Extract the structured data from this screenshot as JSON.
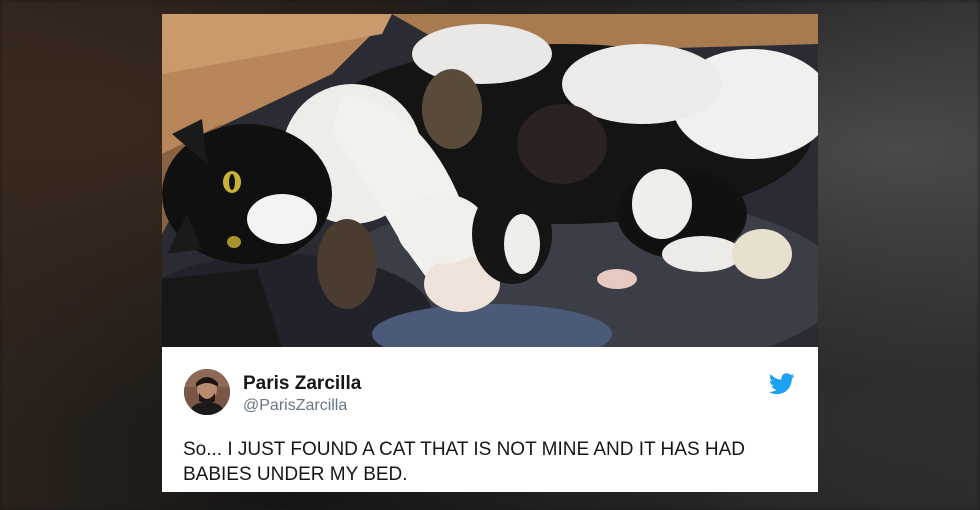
{
  "tweet": {
    "author_name": "Paris Zarcilla",
    "author_handle": "@ParisZarcilla",
    "text": "So... I JUST FOUND A CAT THAT IS NOT MINE AND IT HAS HAD BABIES UNDER MY BED."
  },
  "icons": {
    "brand": "twitter-bird-icon"
  },
  "colors": {
    "twitter_blue": "#1da1f2",
    "name_text": "#14171a",
    "handle_text": "#657786"
  }
}
